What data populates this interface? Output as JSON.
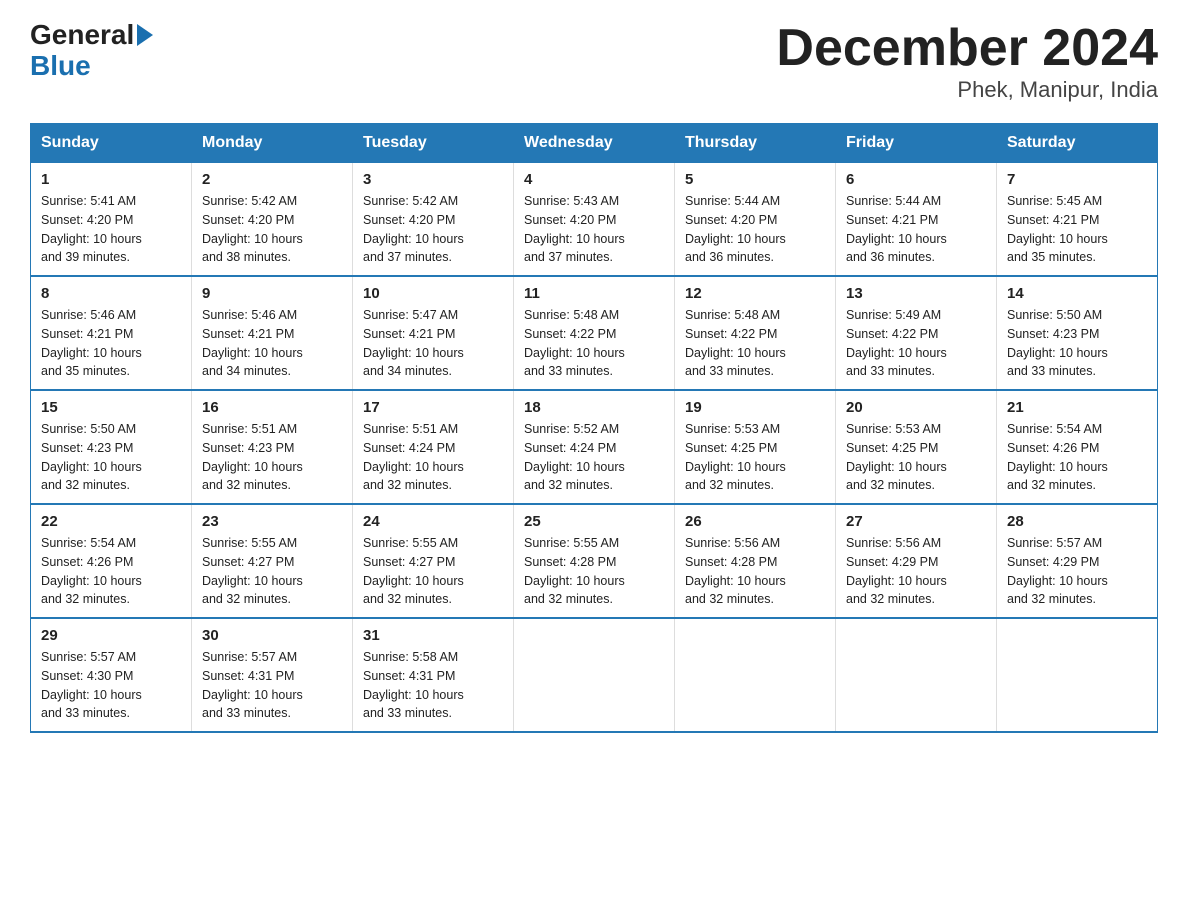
{
  "header": {
    "logo_general": "General",
    "logo_blue": "Blue",
    "title": "December 2024",
    "subtitle": "Phek, Manipur, India"
  },
  "days_of_week": [
    "Sunday",
    "Monday",
    "Tuesday",
    "Wednesday",
    "Thursday",
    "Friday",
    "Saturday"
  ],
  "weeks": [
    [
      {
        "num": "1",
        "sunrise": "5:41 AM",
        "sunset": "4:20 PM",
        "daylight": "10 hours and 39 minutes."
      },
      {
        "num": "2",
        "sunrise": "5:42 AM",
        "sunset": "4:20 PM",
        "daylight": "10 hours and 38 minutes."
      },
      {
        "num": "3",
        "sunrise": "5:42 AM",
        "sunset": "4:20 PM",
        "daylight": "10 hours and 37 minutes."
      },
      {
        "num": "4",
        "sunrise": "5:43 AM",
        "sunset": "4:20 PM",
        "daylight": "10 hours and 37 minutes."
      },
      {
        "num": "5",
        "sunrise": "5:44 AM",
        "sunset": "4:20 PM",
        "daylight": "10 hours and 36 minutes."
      },
      {
        "num": "6",
        "sunrise": "5:44 AM",
        "sunset": "4:21 PM",
        "daylight": "10 hours and 36 minutes."
      },
      {
        "num": "7",
        "sunrise": "5:45 AM",
        "sunset": "4:21 PM",
        "daylight": "10 hours and 35 minutes."
      }
    ],
    [
      {
        "num": "8",
        "sunrise": "5:46 AM",
        "sunset": "4:21 PM",
        "daylight": "10 hours and 35 minutes."
      },
      {
        "num": "9",
        "sunrise": "5:46 AM",
        "sunset": "4:21 PM",
        "daylight": "10 hours and 34 minutes."
      },
      {
        "num": "10",
        "sunrise": "5:47 AM",
        "sunset": "4:21 PM",
        "daylight": "10 hours and 34 minutes."
      },
      {
        "num": "11",
        "sunrise": "5:48 AM",
        "sunset": "4:22 PM",
        "daylight": "10 hours and 33 minutes."
      },
      {
        "num": "12",
        "sunrise": "5:48 AM",
        "sunset": "4:22 PM",
        "daylight": "10 hours and 33 minutes."
      },
      {
        "num": "13",
        "sunrise": "5:49 AM",
        "sunset": "4:22 PM",
        "daylight": "10 hours and 33 minutes."
      },
      {
        "num": "14",
        "sunrise": "5:50 AM",
        "sunset": "4:23 PM",
        "daylight": "10 hours and 33 minutes."
      }
    ],
    [
      {
        "num": "15",
        "sunrise": "5:50 AM",
        "sunset": "4:23 PM",
        "daylight": "10 hours and 32 minutes."
      },
      {
        "num": "16",
        "sunrise": "5:51 AM",
        "sunset": "4:23 PM",
        "daylight": "10 hours and 32 minutes."
      },
      {
        "num": "17",
        "sunrise": "5:51 AM",
        "sunset": "4:24 PM",
        "daylight": "10 hours and 32 minutes."
      },
      {
        "num": "18",
        "sunrise": "5:52 AM",
        "sunset": "4:24 PM",
        "daylight": "10 hours and 32 minutes."
      },
      {
        "num": "19",
        "sunrise": "5:53 AM",
        "sunset": "4:25 PM",
        "daylight": "10 hours and 32 minutes."
      },
      {
        "num": "20",
        "sunrise": "5:53 AM",
        "sunset": "4:25 PM",
        "daylight": "10 hours and 32 minutes."
      },
      {
        "num": "21",
        "sunrise": "5:54 AM",
        "sunset": "4:26 PM",
        "daylight": "10 hours and 32 minutes."
      }
    ],
    [
      {
        "num": "22",
        "sunrise": "5:54 AM",
        "sunset": "4:26 PM",
        "daylight": "10 hours and 32 minutes."
      },
      {
        "num": "23",
        "sunrise": "5:55 AM",
        "sunset": "4:27 PM",
        "daylight": "10 hours and 32 minutes."
      },
      {
        "num": "24",
        "sunrise": "5:55 AM",
        "sunset": "4:27 PM",
        "daylight": "10 hours and 32 minutes."
      },
      {
        "num": "25",
        "sunrise": "5:55 AM",
        "sunset": "4:28 PM",
        "daylight": "10 hours and 32 minutes."
      },
      {
        "num": "26",
        "sunrise": "5:56 AM",
        "sunset": "4:28 PM",
        "daylight": "10 hours and 32 minutes."
      },
      {
        "num": "27",
        "sunrise": "5:56 AM",
        "sunset": "4:29 PM",
        "daylight": "10 hours and 32 minutes."
      },
      {
        "num": "28",
        "sunrise": "5:57 AM",
        "sunset": "4:29 PM",
        "daylight": "10 hours and 32 minutes."
      }
    ],
    [
      {
        "num": "29",
        "sunrise": "5:57 AM",
        "sunset": "4:30 PM",
        "daylight": "10 hours and 33 minutes."
      },
      {
        "num": "30",
        "sunrise": "5:57 AM",
        "sunset": "4:31 PM",
        "daylight": "10 hours and 33 minutes."
      },
      {
        "num": "31",
        "sunrise": "5:58 AM",
        "sunset": "4:31 PM",
        "daylight": "10 hours and 33 minutes."
      },
      null,
      null,
      null,
      null
    ]
  ],
  "labels": {
    "sunrise": "Sunrise:",
    "sunset": "Sunset:",
    "daylight": "Daylight:"
  }
}
